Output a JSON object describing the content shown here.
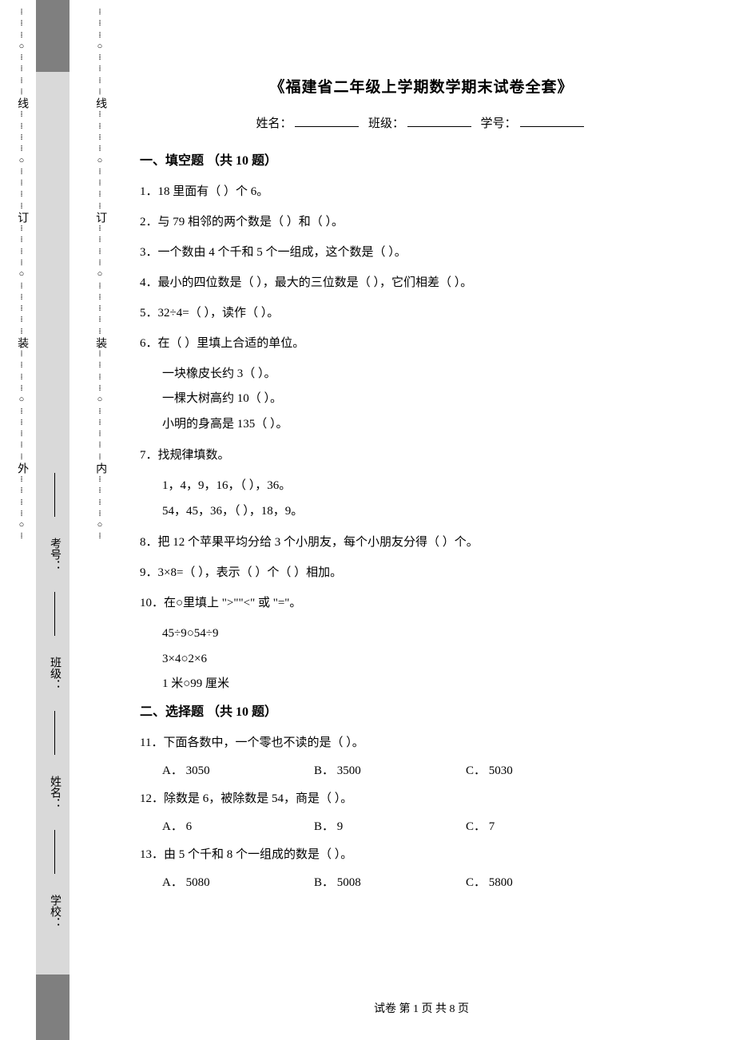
{
  "title": "《福建省二年级上学期数学期末试卷全套》",
  "info": {
    "name_label": "姓名：",
    "class_label": "班级：",
    "id_label": "学号："
  },
  "section1": {
    "header": "一、填空题 （共 10 题）"
  },
  "q1": "1．18 里面有（  ）个 6。",
  "q2": "2．与 79 相邻的两个数是（  ）和（  ）。",
  "q3": "3．一个数由 4 个千和 5 个一组成，这个数是（  ）。",
  "q4": "4．最小的四位数是（  ），最大的三位数是（  ），它们相差（  ）。",
  "q5": "5．32÷4=（  ），读作（  ）。",
  "q6": {
    "stem": "6．在（  ）里填上合适的单位。",
    "a": "一块橡皮长约 3（  ）。",
    "b": "一棵大树高约 10（  ）。",
    "c": "小明的身高是 135（  ）。"
  },
  "q7": {
    "stem": "7．找规律填数。",
    "a": "1，4，9，16，（  ），36。",
    "b": "54，45，36，（  ），18，9。"
  },
  "q8": "8．把 12 个苹果平均分给 3 个小朋友，每个小朋友分得（  ）个。",
  "q9": "9．3×8=（  ），表示（  ）个（  ）相加。",
  "q10": {
    "stem": "10．在○里填上 \">\"\"<\" 或 \"=\"。",
    "a": "45÷9○54÷9",
    "b": "3×4○2×6",
    "c": "1 米○99 厘米"
  },
  "section2": {
    "header": "二、选择题 （共 10 题）"
  },
  "q11": {
    "stem": "11．下面各数中，一个零也不读的是（  ）。",
    "A": "A． 3050",
    "B": "B． 3500",
    "C": "C． 5030"
  },
  "q12": {
    "stem": "12．除数是 6，被除数是 54，商是（  ）。",
    "A": "A． 6",
    "B": "B． 9",
    "C": "C． 7"
  },
  "q13": {
    "stem": "13．由 5 个千和 8 个一组成的数是（  ）。",
    "A": "A． 5080",
    "B": "B． 5008",
    "C": "C． 5800"
  },
  "footer": "试卷 第 1 页 共 8 页",
  "gutter": {
    "outer_chars": [
      "外"
    ],
    "inner_chars": [
      "内"
    ],
    "binder_chars_outer": [
      "线",
      "订",
      "装"
    ],
    "binder_chars_inner": [
      "线",
      "订",
      "装"
    ],
    "labels": {
      "school": "学校：",
      "name": "姓名：",
      "class": "班级：",
      "examno": "考号："
    }
  }
}
